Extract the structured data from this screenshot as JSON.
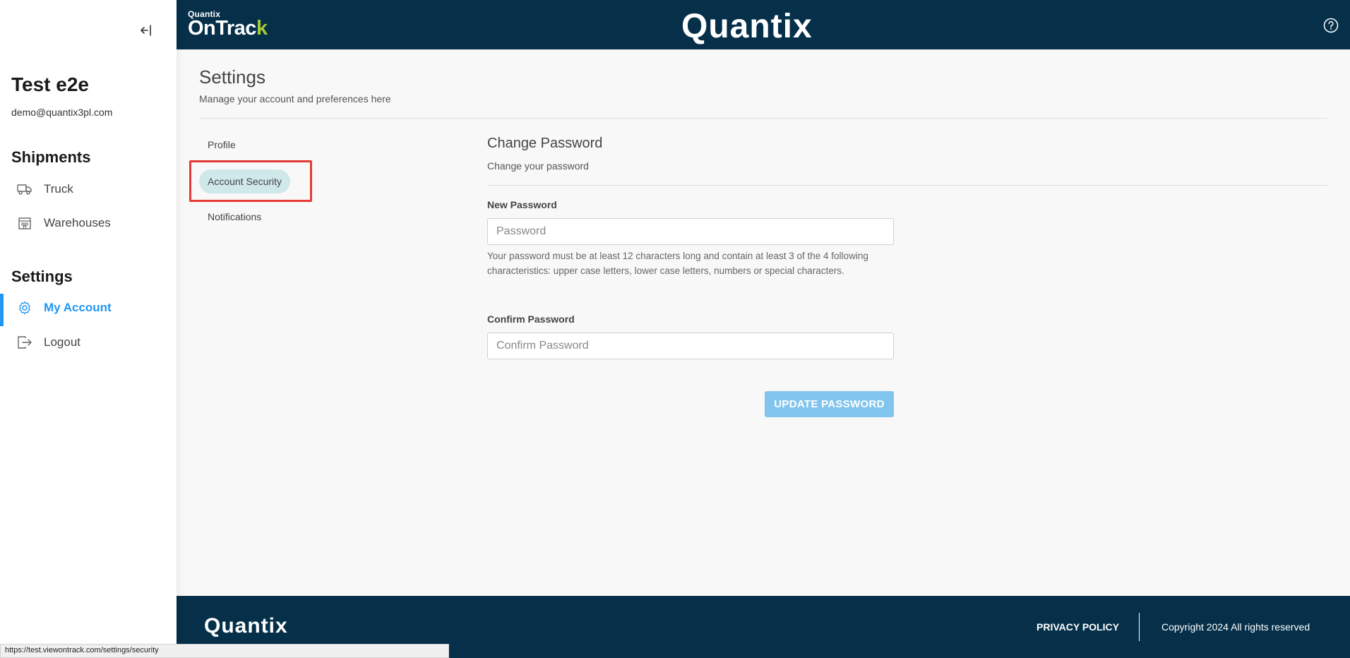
{
  "sidebar": {
    "user_name": "Test e2e",
    "user_email": "demo@quantix3pl.com",
    "shipments_title": "Shipments",
    "shipments_items": [
      {
        "label": "Truck",
        "icon": "truck-icon"
      },
      {
        "label": "Warehouses",
        "icon": "warehouse-icon"
      }
    ],
    "settings_title": "Settings",
    "settings_items": [
      {
        "label": "My Account",
        "icon": "gear-icon",
        "active": true
      },
      {
        "label": "Logout",
        "icon": "logout-icon"
      }
    ],
    "collapse_icon": "collapse-left-icon"
  },
  "header": {
    "ontrack_small": "Quantix",
    "ontrack_big_a": "OnTrac",
    "ontrack_big_b": "k",
    "center_logo": "Quantix",
    "help_icon": "help-circle-icon"
  },
  "settings_page": {
    "title": "Settings",
    "subtitle": "Manage your account and preferences here",
    "tabs": [
      {
        "label": "Profile"
      },
      {
        "label": "Account Security",
        "active": true
      },
      {
        "label": "Notifications"
      }
    ]
  },
  "change_password": {
    "title": "Change Password",
    "subtitle": "Change your password",
    "new_password_label": "New Password",
    "new_password_placeholder": "Password",
    "hint": "Your password must be at least 12 characters long and contain at least 3 of the 4 following characteristics: upper case letters, lower case letters, numbers or special characters.",
    "confirm_password_label": "Confirm Password",
    "confirm_password_placeholder": "Confirm Password",
    "update_button": "UPDATE PASSWORD"
  },
  "footer": {
    "logo": "Quantix",
    "privacy": "PRIVACY POLICY",
    "copyright": "Copyright 2024 All rights reserved"
  },
  "statusbar": {
    "url": "https://test.viewontrack.com/settings/security"
  },
  "colors": {
    "header_bg": "#06304a",
    "accent": "#2196f3",
    "active_tab_bg": "#cfe8ea",
    "button_bg": "#81c4ee",
    "highlight": "#e53935",
    "ontrack_k": "#a6c83a"
  }
}
